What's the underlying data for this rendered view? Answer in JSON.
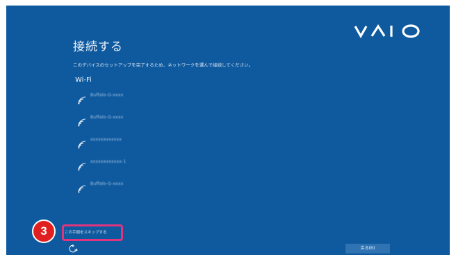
{
  "brand": {
    "logo_text": "VAIO"
  },
  "page": {
    "title": "接続する",
    "subtitle": "このデバイスのセットアップを完了するため、ネットワークを選んで接続してください。",
    "wifi_heading": "Wi-Fi"
  },
  "networks": [
    {
      "name": "Buffalo-G-xxxx",
      "icon": "wifi-icon"
    },
    {
      "name": "Buffalo-G-xxxx",
      "icon": "wifi-icon"
    },
    {
      "name": "xxxxxxxxxxxx",
      "icon": "wifi-icon"
    },
    {
      "name": "xxxxxxxxxxxx-1",
      "icon": "wifi-icon"
    },
    {
      "name": "Buffalo-G-xxxx",
      "icon": "wifi-icon"
    }
  ],
  "footer": {
    "skip_label": "この手順をスキップする",
    "back_label": "戻る(B)",
    "accessibility_icon": "ease-of-access-icon"
  },
  "annotation": {
    "step_number": "3"
  },
  "colors": {
    "background": "#0f5a9f",
    "highlight": "#e0357e",
    "badge": "#e02020"
  }
}
